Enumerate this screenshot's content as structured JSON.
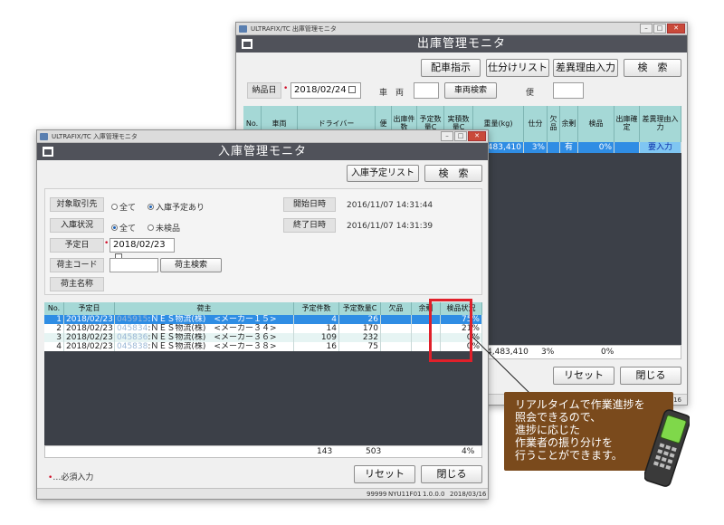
{
  "colors": {
    "header": "#50525a",
    "grid_header": "#a5d8d6",
    "selected_row": "#2f8de4",
    "highlight_box": "#e0202a",
    "callout": "#7a4a1c",
    "grid_bg": "#3c4048"
  },
  "shipping": {
    "window_title": "ULTRAFIX/TC 出庫管理モニタ",
    "header_title": "出庫管理モニタ",
    "buttons": {
      "dispatch": "配車指示",
      "sort_list": "仕分けリスト",
      "reason_input": "差異理由入力",
      "search": "検　索",
      "reset": "リセット",
      "close": "閉じる"
    },
    "delivery_date_label": "納品日",
    "delivery_date_value": "2018/02/24",
    "vehicle_label": "車　両",
    "vehicle_search": "車両検索",
    "flight_label": "便",
    "columns": [
      "No.",
      "車両",
      "ドライバー",
      "便",
      "出庫件数",
      "予定数量C",
      "実積数量C",
      "重量(kg)",
      "仕分",
      "欠品",
      "余剰",
      "検品",
      "出庫確定",
      "差異理由入力"
    ],
    "row1": {
      "weight": "4,483,410",
      "sort": "3%",
      "exists": "有",
      "inspect": "0%",
      "reason": "要入力"
    },
    "total": {
      "weight": "4,483,410",
      "sort": "3%",
      "inspect": "0%"
    },
    "status_tail": "16"
  },
  "receiving": {
    "window_title": "ULTRAFIX/TC 入庫管理モニタ",
    "header_title": "入庫管理モニタ",
    "buttons": {
      "planned_list": "入庫予定リスト",
      "search": "検　索",
      "shipper_search": "荷主検索",
      "reset": "リセット",
      "close": "閉じる"
    },
    "filters": {
      "target_label": "対象取引先",
      "target_opt_all": "全て",
      "target_opt_planned": "入庫予定あり",
      "status_label": "入庫状況",
      "status_opt_all": "全て",
      "status_opt_uninspected": "未検品",
      "date_label": "予定日",
      "date_value": "2018/02/23",
      "shipper_code_label": "荷主コード",
      "shipper_name_label": "荷主名称",
      "start_label": "開始日時",
      "start_value": "2016/11/07 14:31:44",
      "end_label": "終了日時",
      "end_value": "2016/11/07 14:31:39"
    },
    "columns": [
      "No.",
      "予定日",
      "荷主",
      "予定件数",
      "予定数量C",
      "欠品",
      "余剰",
      "検品状況"
    ],
    "rows": [
      {
        "no": "1",
        "date": "2018/02/23",
        "code": "045915",
        "name": ":ＮＥＳ物流(株)　<メーカー１５>",
        "count": "4",
        "qty": "26",
        "shortage": "",
        "surplus": "",
        "status": "75%"
      },
      {
        "no": "2",
        "date": "2018/02/23",
        "code": "045834",
        "name": ":ＮＥＳ物流(株)　<メーカー３４>",
        "count": "14",
        "qty": "170",
        "shortage": "",
        "surplus": "",
        "status": "21%"
      },
      {
        "no": "3",
        "date": "2018/02/23",
        "code": "045836",
        "name": ":ＮＥＳ物流(株)　<メーカー３６>",
        "count": "109",
        "qty": "232",
        "shortage": "",
        "surplus": "",
        "status": "0%"
      },
      {
        "no": "4",
        "date": "2018/02/23",
        "code": "045838",
        "name": ":ＮＥＳ物流(株)　<メーカー３８>",
        "count": "16",
        "qty": "75",
        "shortage": "",
        "surplus": "",
        "status": "0%"
      }
    ],
    "totals": {
      "count": "143",
      "qty": "503",
      "status": "4%"
    },
    "required_note": "…必須入力",
    "status_bar": {
      "code": "99999",
      "screen": "NYU11F01",
      "version": "1.0.0.0",
      "date": "2018/03/16"
    }
  },
  "callout": {
    "lines": [
      "リアルタイムで作業進捗を",
      "照会できるので、",
      "進捗に応じた",
      "作業者の振り分けを",
      "行うことができます。"
    ]
  }
}
